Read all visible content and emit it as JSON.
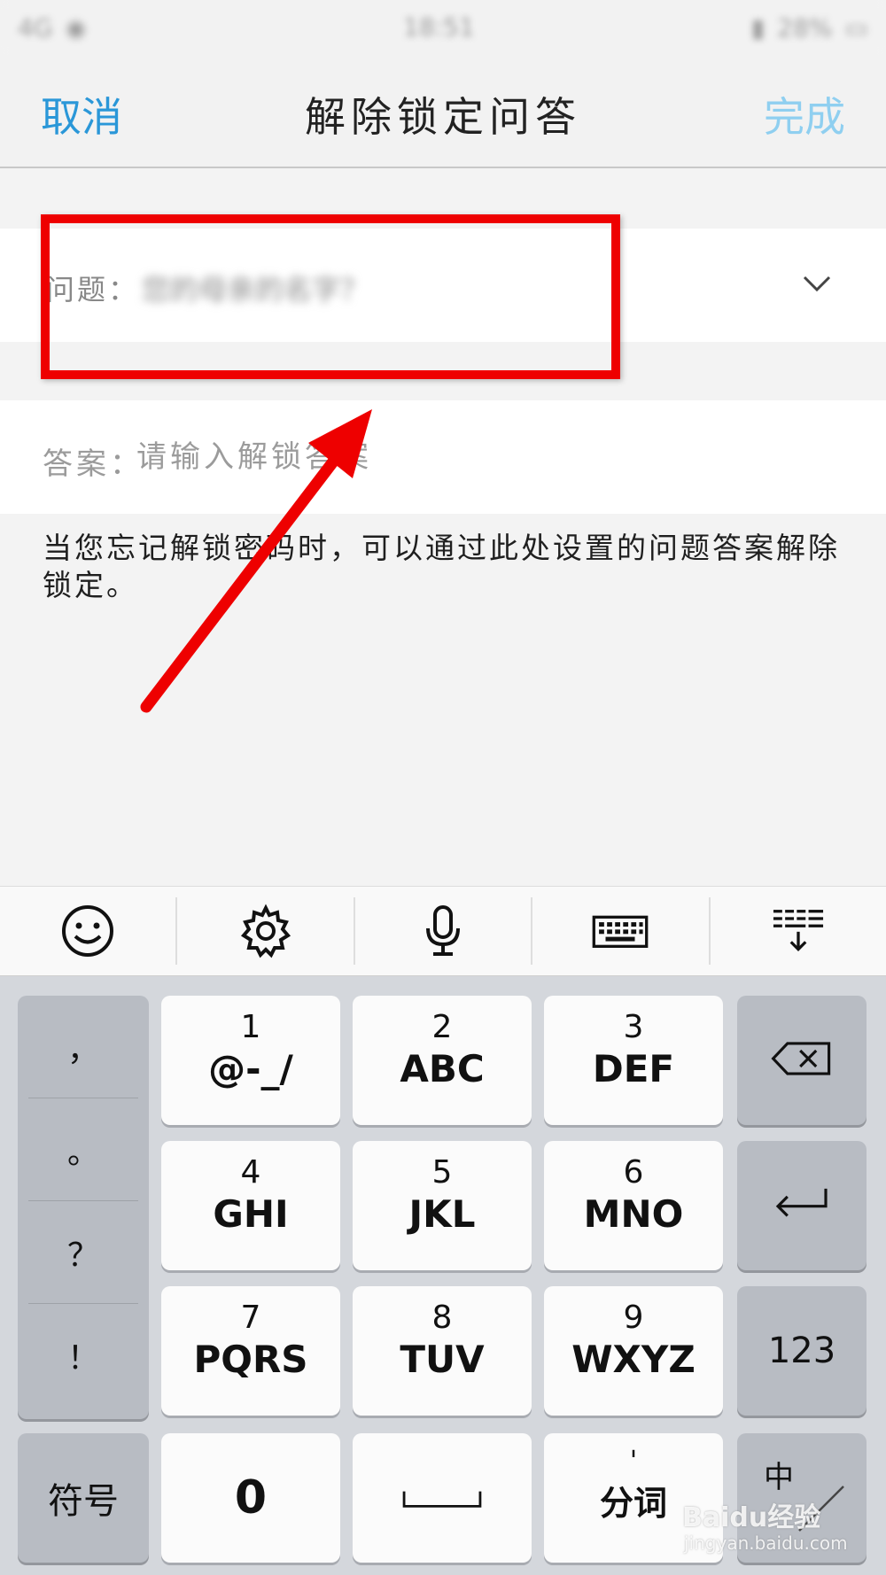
{
  "status_bar": {
    "carrier": "4G",
    "time": "18:51",
    "battery": "28%"
  },
  "nav": {
    "cancel_label": "取消",
    "title": "解除锁定问答",
    "done_label": "完成"
  },
  "question": {
    "label": "问题：",
    "value": "您的母亲的名字？"
  },
  "answer": {
    "label": "答案：",
    "placeholder": "请输入解锁答案"
  },
  "hint": "当您忘记解锁密码时，可以通过此处设置的问题答案解除锁定。",
  "keyboard": {
    "toolbar": [
      "emoji-icon",
      "gear-icon",
      "microphone-icon",
      "keyboard-icon",
      "collapse-keyboard-icon"
    ],
    "punctuation": [
      "，",
      "。",
      "？",
      "！"
    ],
    "keys": [
      {
        "num": "1",
        "letters": "@-_/"
      },
      {
        "num": "2",
        "letters": "ABC"
      },
      {
        "num": "3",
        "letters": "DEF"
      },
      {
        "num": "4",
        "letters": "GHI"
      },
      {
        "num": "5",
        "letters": "JKL"
      },
      {
        "num": "6",
        "letters": "MNO"
      },
      {
        "num": "7",
        "letters": "PQRS"
      },
      {
        "num": "8",
        "letters": "TUV"
      },
      {
        "num": "9",
        "letters": "WXYZ"
      }
    ],
    "numeric_switch": "123",
    "symbol_key": "符号",
    "zero_key": "0",
    "segment_label": "分词",
    "segment_mark": "'",
    "lang_key": "中"
  },
  "watermark": {
    "brand": "Baidu经验",
    "url": "jingyan.baidu.com"
  },
  "colors": {
    "accent": "#2a97d8",
    "accent_disabled": "#8fcff0",
    "highlight": "#ee0000"
  }
}
